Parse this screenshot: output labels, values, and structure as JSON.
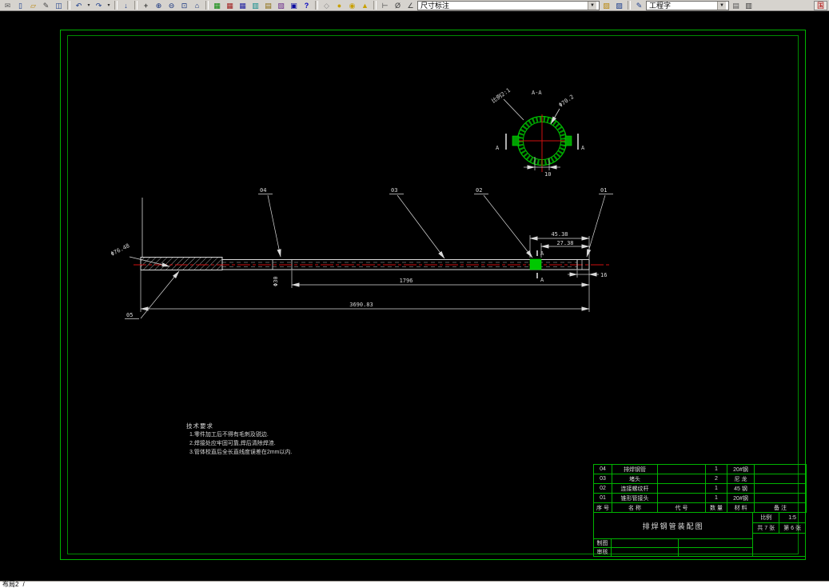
{
  "toolbar": {
    "dim_style_combo": "尺寸标注",
    "text_style_combo": "工程字",
    "ime_label": "国",
    "left_items": [
      {
        "name": "send-mail-icon",
        "cls": "tb-item tb-icon",
        "glyph": "✉",
        "style": "color:#606060",
        "inter": "true"
      },
      {
        "name": "new-file-icon",
        "cls": "tb-item tb-icon",
        "glyph": "▯",
        "style": "color:#1a3c8c",
        "inter": "true"
      },
      {
        "name": "open-file-icon",
        "cls": "tb-item tb-icon",
        "glyph": "▱",
        "style": "color:#b8860b",
        "inter": "true"
      },
      {
        "name": "edit-pen-icon",
        "cls": "tb-item tb-icon",
        "glyph": "✎",
        "style": "color:#444444",
        "inter": "true"
      },
      {
        "name": "print-preview-icon",
        "cls": "tb-item tb-icon",
        "glyph": "◫",
        "style": "color:#1a3c8c",
        "inter": "true"
      },
      {
        "name": "toolbar-separator",
        "cls": "tb-item tb-sep",
        "glyph": "",
        "style": "",
        "inter": "false"
      },
      {
        "name": "undo-icon",
        "cls": "tb-item tb-icon",
        "glyph": "↶",
        "style": "color:#1a3c8c",
        "inter": "true"
      },
      {
        "name": "undo-dropdown-icon",
        "cls": "tb-item tb-drop",
        "glyph": "▾",
        "style": "",
        "inter": "true"
      },
      {
        "name": "redo-icon",
        "cls": "tb-item tb-icon",
        "glyph": "↷",
        "style": "color:#1a3c8c",
        "inter": "true"
      },
      {
        "name": "redo-dropdown-icon",
        "cls": "tb-item tb-drop",
        "glyph": "▾",
        "style": "",
        "inter": "true"
      },
      {
        "name": "toolbar-separator",
        "cls": "tb-item tb-sep",
        "glyph": "",
        "style": "",
        "inter": "false"
      },
      {
        "name": "insert-block-icon",
        "cls": "tb-item tb-icon",
        "glyph": "↓",
        "style": "color:#1a3c8c",
        "inter": "true"
      },
      {
        "name": "toolbar-separator",
        "cls": "tb-item tb-sep",
        "glyph": "",
        "style": "",
        "inter": "false"
      },
      {
        "name": "pan-icon",
        "cls": "tb-item tb-icon",
        "glyph": "+",
        "style": "color:#404040;font-weight:bold",
        "inter": "true"
      },
      {
        "name": "zoom-in-icon",
        "cls": "tb-item tb-icon",
        "glyph": "⊕",
        "style": "color:#14327d",
        "inter": "true"
      },
      {
        "name": "zoom-out-icon",
        "cls": "tb-item tb-icon",
        "glyph": "⊖",
        "style": "color:#14327d",
        "inter": "true"
      },
      {
        "name": "zoom-window-icon",
        "cls": "tb-item tb-icon",
        "glyph": "⊡",
        "style": "color:#14327d",
        "inter": "true"
      },
      {
        "name": "zoom-extents-icon",
        "cls": "tb-item tb-icon",
        "glyph": "⌂",
        "style": "color:#14327d",
        "inter": "true"
      },
      {
        "name": "toolbar-separator",
        "cls": "tb-item tb-sep",
        "glyph": "",
        "style": "",
        "inter": "false"
      },
      {
        "name": "table-tool-green-icon",
        "cls": "tb-item tb-icon",
        "glyph": "▦",
        "style": "color:#0a8a0a",
        "inter": "true"
      },
      {
        "name": "table-tool-red-icon",
        "cls": "tb-item tb-icon",
        "glyph": "▦",
        "style": "color:#a02020",
        "inter": "true"
      },
      {
        "name": "table-tool-blue-icon",
        "cls": "tb-item tb-icon",
        "glyph": "▦",
        "style": "color:#2020a0",
        "inter": "true"
      },
      {
        "name": "table-tool-cyan-icon",
        "cls": "tb-item tb-icon",
        "glyph": "▥",
        "style": "color:#0a8a8a",
        "inter": "true"
      },
      {
        "name": "table-tool-olive-icon",
        "cls": "tb-item tb-icon",
        "glyph": "▤",
        "style": "color:#8a6a0a",
        "inter": "true"
      },
      {
        "name": "table-tool-purple-icon",
        "cls": "tb-item tb-icon",
        "glyph": "▧",
        "style": "color:#6a2a8a",
        "inter": "true"
      },
      {
        "name": "ole-object-icon",
        "cls": "tb-item tb-icon",
        "glyph": "▣",
        "style": "color:#0a0aa0",
        "inter": "true"
      },
      {
        "name": "help-icon",
        "cls": "tb-item tb-icon",
        "glyph": "?",
        "style": "color:#0000c0;font-weight:bold",
        "inter": "true"
      },
      {
        "name": "toolbar-separator",
        "cls": "tb-item tb-sep",
        "glyph": "",
        "style": "",
        "inter": "false"
      },
      {
        "name": "surface-tool-icon",
        "cls": "tb-item tb-icon",
        "glyph": "◇",
        "style": "color:#8a8a8a",
        "inter": "true"
      },
      {
        "name": "sphere-tool-icon",
        "cls": "tb-item tb-icon",
        "glyph": "●",
        "style": "color:#c8a000",
        "inter": "true"
      },
      {
        "name": "torus-tool-icon",
        "cls": "tb-item tb-icon",
        "glyph": "◉",
        "style": "color:#c8a000",
        "inter": "true"
      },
      {
        "name": "cone-tool-icon",
        "cls": "tb-item tb-icon",
        "glyph": "▲",
        "style": "color:#c8a000",
        "inter": "true"
      },
      {
        "name": "toolbar-separator",
        "cls": "tb-item tb-sep",
        "glyph": "",
        "style": "",
        "inter": "false"
      },
      {
        "name": "dim-linear-icon",
        "cls": "tb-item tb-icon",
        "glyph": "⊢",
        "style": "color:#404040",
        "inter": "true"
      },
      {
        "name": "dim-diameter-icon",
        "cls": "tb-item tb-icon",
        "glyph": "Ø",
        "style": "color:#404040",
        "inter": "true"
      },
      {
        "name": "dim-angular-icon",
        "cls": "tb-item tb-icon",
        "glyph": "∠",
        "style": "color:#404040",
        "inter": "true"
      }
    ],
    "mid_items": [
      {
        "name": "layer-stack-icon",
        "cls": "tb-item tb-icon",
        "glyph": "▨",
        "style": "color:#b8860b",
        "inter": "true"
      },
      {
        "name": "layer-stack-blue-icon",
        "cls": "tb-item tb-icon",
        "glyph": "▨",
        "style": "color:#1a3c8c",
        "inter": "true"
      },
      {
        "name": "toolbar-separator",
        "cls": "tb-item tb-sep",
        "glyph": "",
        "style": "",
        "inter": "false"
      },
      {
        "name": "text-pen-icon",
        "cls": "tb-item tb-icon",
        "glyph": "✎",
        "style": "color:#1a3c8c",
        "inter": "true"
      }
    ],
    "right_items": [
      {
        "name": "style-manager-icon",
        "cls": "tb-item tb-icon",
        "glyph": "▤",
        "style": "color:#555555",
        "inter": "true"
      },
      {
        "name": "plot-icon",
        "cls": "tb-item tb-icon",
        "glyph": "▥",
        "style": "color:#333333",
        "inter": "true"
      }
    ]
  },
  "statusbar": {
    "layout_tab": "布局2",
    "tab_divider": "/"
  },
  "drawing": {
    "section_view": {
      "title": "A-A",
      "scale_note": "比例2:1",
      "dia_label": "Φ70.2",
      "width_dim": "10",
      "cut_label_left": "A",
      "cut_label_right": "A"
    },
    "main_view": {
      "dim_1796": "1796",
      "dim_total": "3690.83",
      "dim_45": "45.38",
      "dim_27": "27.38",
      "dim_16": "16",
      "dim_dia30": "Φ30",
      "dia_left": "Φ76.48",
      "cut_a_top": "A",
      "cut_a_bottom": "A",
      "callout_01": "01",
      "callout_02": "02",
      "callout_03": "03",
      "callout_04": "04",
      "callout_05": "05"
    },
    "notes": {
      "title": "技术要求",
      "lines": [
        "1.零件加工后不得有毛刺及锐边.",
        "2.焊接处应牢固可靠,焊后清除焊渣.",
        "3.管体校直后全长直线度误差在2mm以内."
      ]
    },
    "title_block": {
      "parts": [
        {
          "no": "04",
          "name": "排焊钢管",
          "code": "",
          "qty": "1",
          "material": "20#钢",
          "note": ""
        },
        {
          "no": "03",
          "name": "堵头",
          "code": "",
          "qty": "2",
          "material": "尼 龙",
          "note": ""
        },
        {
          "no": "02",
          "name": "连接螺纹杆",
          "code": "",
          "qty": "1",
          "material": "45 钢",
          "note": ""
        },
        {
          "no": "01",
          "name": "锥形管接头",
          "code": "",
          "qty": "1",
          "material": "20#钢",
          "note": ""
        }
      ],
      "header": {
        "no": "序 号",
        "name": "名  称",
        "code": "代  号",
        "qty": "数 量",
        "material": "材  料",
        "note": "备  注"
      },
      "drawing_title": "排焊钢管装配图",
      "scale_label": "比例",
      "scale_value": "1:5",
      "sheet_total": "共 7 张",
      "sheet_no": "第 6 张",
      "maker_label": "制图",
      "checker_label": "审核"
    }
  }
}
